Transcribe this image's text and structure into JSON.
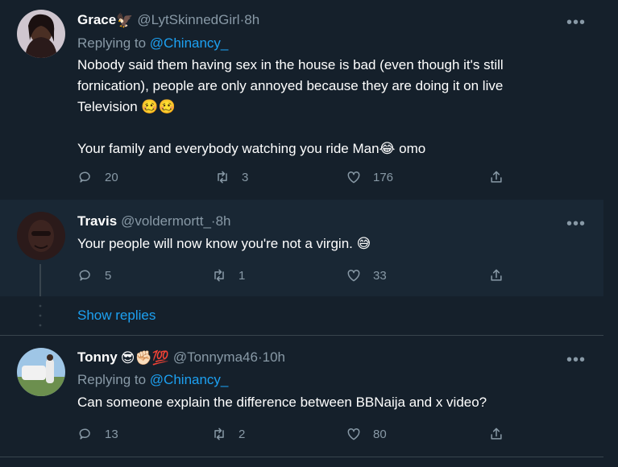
{
  "tweets": [
    {
      "name": "Grace",
      "handle": "@LytSkinnedGirl",
      "time": "8h",
      "replying_label": "Replying to",
      "replying_to": "@Chinancy_",
      "body_lines": [
        "Nobody said them having sex in the house is bad (even though it's still",
        "fornication), people are only annoyed because they are doing it on live",
        "Television 🥴🥴",
        "",
        "Your family and everybody watching you ride Man😂 omo"
      ],
      "replies": "20",
      "retweets": "3",
      "likes": "176"
    },
    {
      "name": "Travis",
      "handle": "@voldermortt_",
      "time": "8h",
      "body_lines": [
        "Your people will now know you're not a virgin. 😅"
      ],
      "replies": "5",
      "retweets": "1",
      "likes": "33"
    },
    {
      "name": "Tonny",
      "handle": "@Tonnyma46",
      "time": "10h",
      "replying_label": "Replying to",
      "replying_to": "@Chinancy_",
      "body_lines": [
        "Can someone explain the difference between BBNaija and x video?"
      ],
      "replies": "13",
      "retweets": "2",
      "likes": "80"
    }
  ],
  "show_replies": "Show replies",
  "separator": " · ",
  "more_glyph": "•••",
  "name_emoji": {
    "grace": "🦅",
    "tonny": [
      "😎",
      "✊🏻",
      "💯"
    ]
  },
  "colors": {
    "background": "#15202b",
    "hover": "#192734",
    "accent": "#1da1f2",
    "muted": "#8899a6",
    "border": "#38444d"
  }
}
